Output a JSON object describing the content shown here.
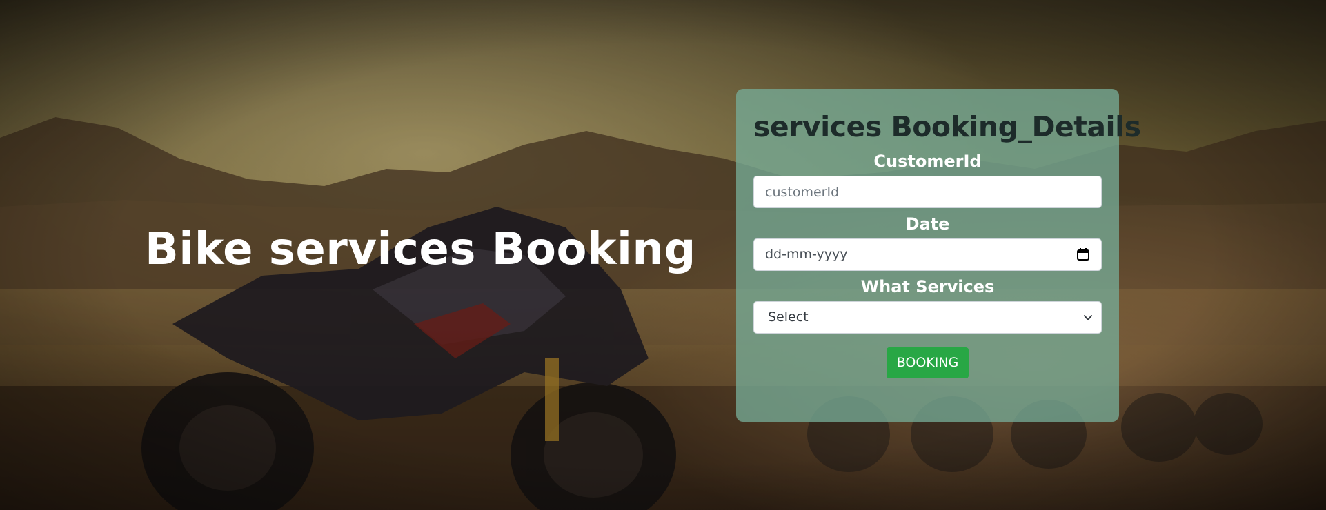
{
  "hero": {
    "title": "Bike services Booking"
  },
  "form": {
    "title": "services Booking_Details",
    "customer_id_label": "CustomerId",
    "customer_id_placeholder": "customerId",
    "date_label": "Date",
    "date_value": "dd-mm-yyyy",
    "services_label": "What Services",
    "services_selected": "Select",
    "submit_label": "BOOKING"
  },
  "colors": {
    "card_background": "#76aa96",
    "button": "#28a745",
    "title_text": "#1d2b2a",
    "label_text": "#ffffff"
  },
  "icons": {
    "date": "calendar-icon",
    "select": "chevron-down-icon"
  }
}
